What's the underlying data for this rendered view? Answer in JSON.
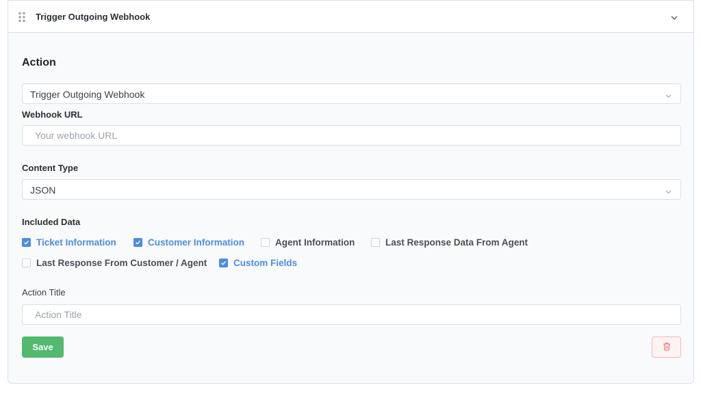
{
  "header": {
    "title": "Trigger Outgoing Webhook",
    "drag_icon": "drag-handle-icon",
    "collapse_icon": "chevron-down-icon"
  },
  "action": {
    "section_title": "Action",
    "selected": "Trigger Outgoing Webhook"
  },
  "webhook_url": {
    "label": "Webhook URL",
    "value": "",
    "placeholder": "Your webhook URL"
  },
  "content_type": {
    "label": "Content Type",
    "selected": "JSON"
  },
  "included_data": {
    "label": "Included Data",
    "options": [
      {
        "label": "Ticket Information",
        "checked": true
      },
      {
        "label": "Customer Information",
        "checked": true
      },
      {
        "label": "Agent Information",
        "checked": false
      },
      {
        "label": "Last Response Data From Agent",
        "checked": false
      },
      {
        "label": "Last Response From Customer / Agent",
        "checked": false
      },
      {
        "label": "Custom Fields",
        "checked": true
      }
    ]
  },
  "action_title": {
    "label": "Action Title",
    "value": "",
    "placeholder": "Action Title"
  },
  "buttons": {
    "save_label": "Save",
    "delete_icon": "trash-icon"
  },
  "colors": {
    "accent": "#4c8ddf",
    "save": "#52b96f",
    "danger": "#e57373"
  }
}
